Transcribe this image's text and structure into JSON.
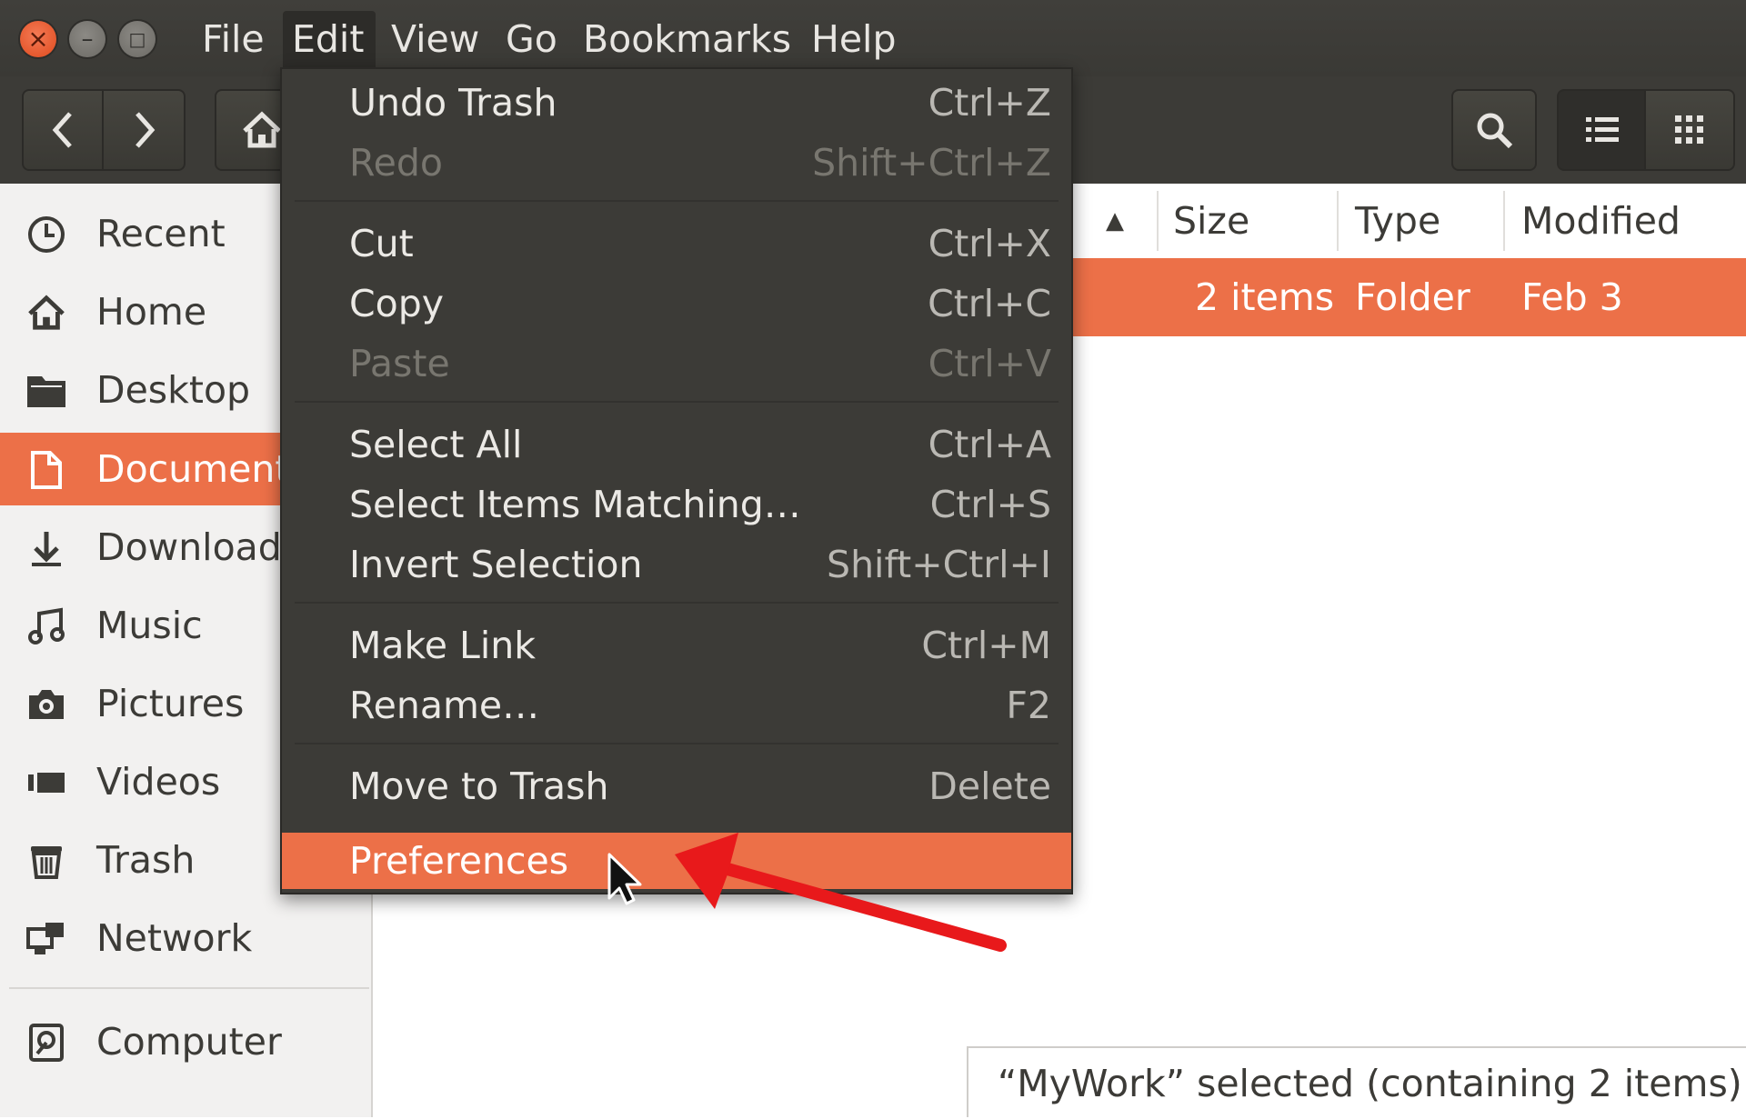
{
  "menubar": {
    "window_buttons": {
      "close": "close-icon",
      "minimize": "minimize-icon",
      "maximize": "maximize-icon"
    },
    "menus": [
      "File",
      "Edit",
      "View",
      "Go",
      "Bookmarks",
      "Help"
    ],
    "active_menu": "Edit"
  },
  "toolbar": {
    "back_icon": "chevron-left-icon",
    "forward_icon": "chevron-right-icon",
    "home_icon": "home-icon",
    "search_icon": "search-icon",
    "list_view_icon": "list-view-icon",
    "grid_view_icon": "grid-view-icon"
  },
  "sidebar": {
    "items": [
      {
        "label": "Recent",
        "icon": "clock-icon"
      },
      {
        "label": "Home",
        "icon": "home-icon"
      },
      {
        "label": "Desktop",
        "icon": "folder-icon"
      },
      {
        "label": "Documents",
        "icon": "document-icon",
        "active": true
      },
      {
        "label": "Downloads",
        "icon": "download-icon"
      },
      {
        "label": "Music",
        "icon": "music-icon"
      },
      {
        "label": "Pictures",
        "icon": "camera-icon"
      },
      {
        "label": "Videos",
        "icon": "video-icon"
      },
      {
        "label": "Trash",
        "icon": "trash-icon"
      },
      {
        "label": "Network",
        "icon": "network-icon"
      },
      {
        "label": "Computer",
        "icon": "drive-icon"
      }
    ]
  },
  "file_list": {
    "sort_indicator": "▲",
    "columns": [
      "Size",
      "Type",
      "Modified"
    ],
    "selected_row": {
      "size": "2 items",
      "type": "Folder",
      "modified": "Feb 3"
    }
  },
  "edit_menu": {
    "items": [
      {
        "label": "Undo Trash",
        "accel": "Ctrl+Z"
      },
      {
        "label": "Redo",
        "accel": "Shift+Ctrl+Z",
        "disabled": true
      },
      {
        "label": "Cut",
        "accel": "Ctrl+X"
      },
      {
        "label": "Copy",
        "accel": "Ctrl+C"
      },
      {
        "label": "Paste",
        "accel": "Ctrl+V",
        "disabled": true
      },
      {
        "label": "Select All",
        "accel": "Ctrl+A"
      },
      {
        "label": "Select Items Matching…",
        "accel": "Ctrl+S"
      },
      {
        "label": "Invert Selection",
        "accel": "Shift+Ctrl+I"
      },
      {
        "label": "Make Link",
        "accel": "Ctrl+M"
      },
      {
        "label": "Rename…",
        "accel": "F2"
      },
      {
        "label": "Move to Trash",
        "accel": "Delete"
      },
      {
        "label": "Preferences",
        "accel": "",
        "highlighted": true
      }
    ]
  },
  "status_bar": {
    "text": "“MyWork” selected  (containing 2 items)"
  },
  "colors": {
    "accent": "#ec7048",
    "menu_bg": "#3c3b37",
    "annotation_arrow": "#e8191b"
  }
}
